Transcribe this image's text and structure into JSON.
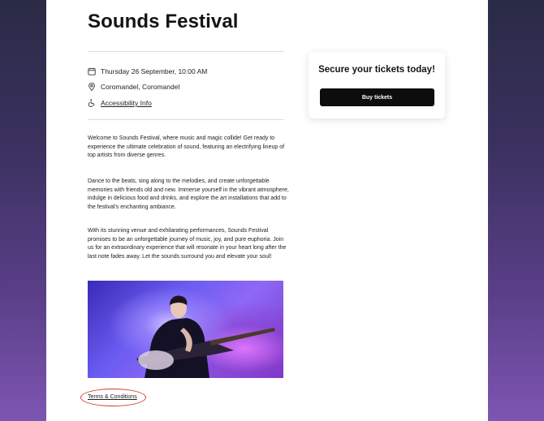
{
  "event": {
    "title": "Sounds Festival",
    "datetime": "Thursday 26 September, 10:00 AM",
    "location": "Coromandel, Coromandel",
    "accessibility_link": "Accessibility Info"
  },
  "description": {
    "paragraphs": [
      "Welcome to Sounds Festival, where music and magic collide! Get ready to experience the ultimate celebration of sound, featuring an electrifying lineup of top artists from diverse genres.",
      "Dance to the beats, sing along to the melodies, and create unforgettable memories with friends old and new. Immerse yourself in the vibrant atmosphere, indulge in delicious food and drinks, and explore the art installations that add to the festival's enchanting ambiance.",
      "With its stunning venue and exhilarating performances, Sounds Festival promises to be an unforgettable journey of music, joy, and pure euphoria. Join us for an extraordinary experience that will resonate in your heart long after the last note fades away. Let the sounds surround you and elevate your soul!"
    ]
  },
  "footer": {
    "terms_link": "Terms & Conditions"
  },
  "ticket_card": {
    "heading": "Secure your tickets today!",
    "button_label": "Buy tickets"
  },
  "colors": {
    "highlight_circle": "#d23a2f",
    "button_bg": "#0d0d0d"
  }
}
